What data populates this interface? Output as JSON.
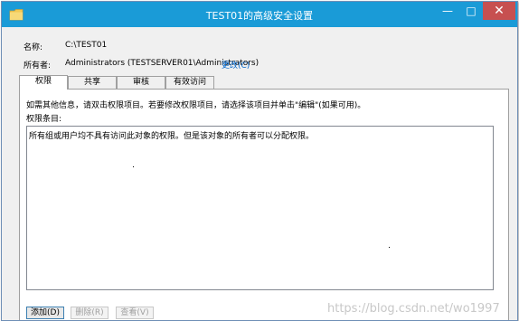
{
  "window": {
    "title": "TEST01的高级安全设置",
    "controls": {
      "minimize": "—",
      "maximize": "□",
      "close": "✕"
    }
  },
  "fields": {
    "name_label": "名称:",
    "name_value": "C:\\TEST01",
    "owner_label": "所有者:",
    "owner_value": "Administrators (TESTSERVER01\\Administrators)",
    "change_link": "更改(C)"
  },
  "tabs": [
    {
      "label": "权限",
      "active": true
    },
    {
      "label": "共享",
      "active": false
    },
    {
      "label": "审核",
      "active": false
    },
    {
      "label": "有效访问",
      "active": false
    }
  ],
  "permissions": {
    "info_text": "如需其他信息，请双击权限项目。若要修改权限项目，请选择该项目并单击\"编辑\"(如果可用)。",
    "entries_label": "权限条目:",
    "empty_message": "所有组或用户均不具有访问此对象的权限。但是该对象的所有者可以分配权限。"
  },
  "buttons": {
    "add": "添加(D)",
    "remove": "删除(R)",
    "view": "查看(V)"
  },
  "watermark": "https://blog.csdn.net/wo1997"
}
